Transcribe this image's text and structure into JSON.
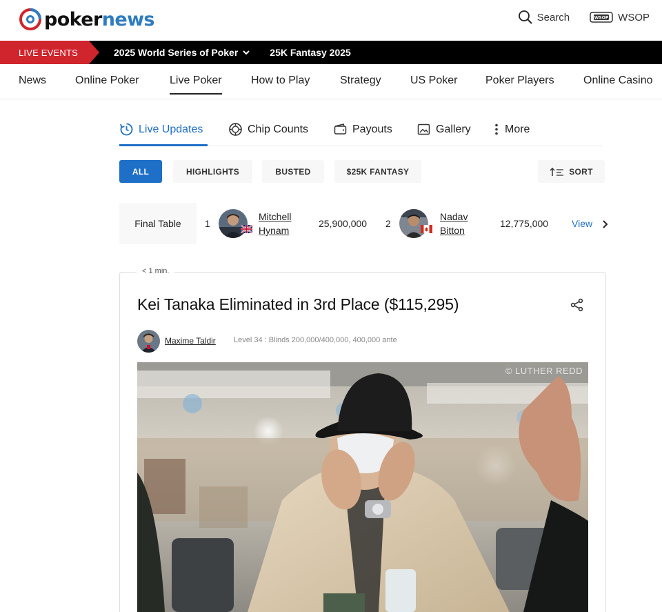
{
  "header": {
    "logo_part1": "poker",
    "logo_part2": "news",
    "search_label": "Search",
    "wsop_label": "WSOP",
    "wsop_badge": "WSOP"
  },
  "livebar": {
    "tag": "LIVE EVENTS",
    "links": [
      "2025 World Series of Poker",
      "25K Fantasy 2025"
    ]
  },
  "nav": {
    "items": [
      "News",
      "Online Poker",
      "Live Poker",
      "How to Play",
      "Strategy",
      "US Poker",
      "Poker Players",
      "Online Casino"
    ],
    "active": "Live Poker"
  },
  "subtabs": {
    "items": [
      "Live Updates",
      "Chip Counts",
      "Payouts",
      "Gallery",
      "More"
    ],
    "active": "Live Updates"
  },
  "filters": {
    "items": [
      "ALL",
      "HIGHLIGHTS",
      "BUSTED",
      "$25K FANTASY"
    ],
    "active": "ALL",
    "sort_label": "SORT"
  },
  "final_table": {
    "label": "Final Table",
    "players": [
      {
        "rank": "1",
        "first": "Mitchell",
        "last": "Hynam",
        "chips": "25,900,000",
        "flag": "uk"
      },
      {
        "rank": "2",
        "first": "Nadav",
        "last": "Bitton",
        "chips": "12,775,000",
        "flag": "canada"
      }
    ],
    "view_label": "View"
  },
  "article": {
    "time_ago": "< 1 min.",
    "headline": "Kei Tanaka Eliminated in 3rd Place ($115,295)",
    "author": "Maxime Taldir",
    "level": "Level 34 : Blinds 200,000/400,000, 400,000 ante",
    "photo_credit": "© LUTHER REDD"
  },
  "colors": {
    "brand_blue": "#2e7cc0",
    "accent_blue": "#1e6fc8",
    "live_red": "#d0252d"
  }
}
